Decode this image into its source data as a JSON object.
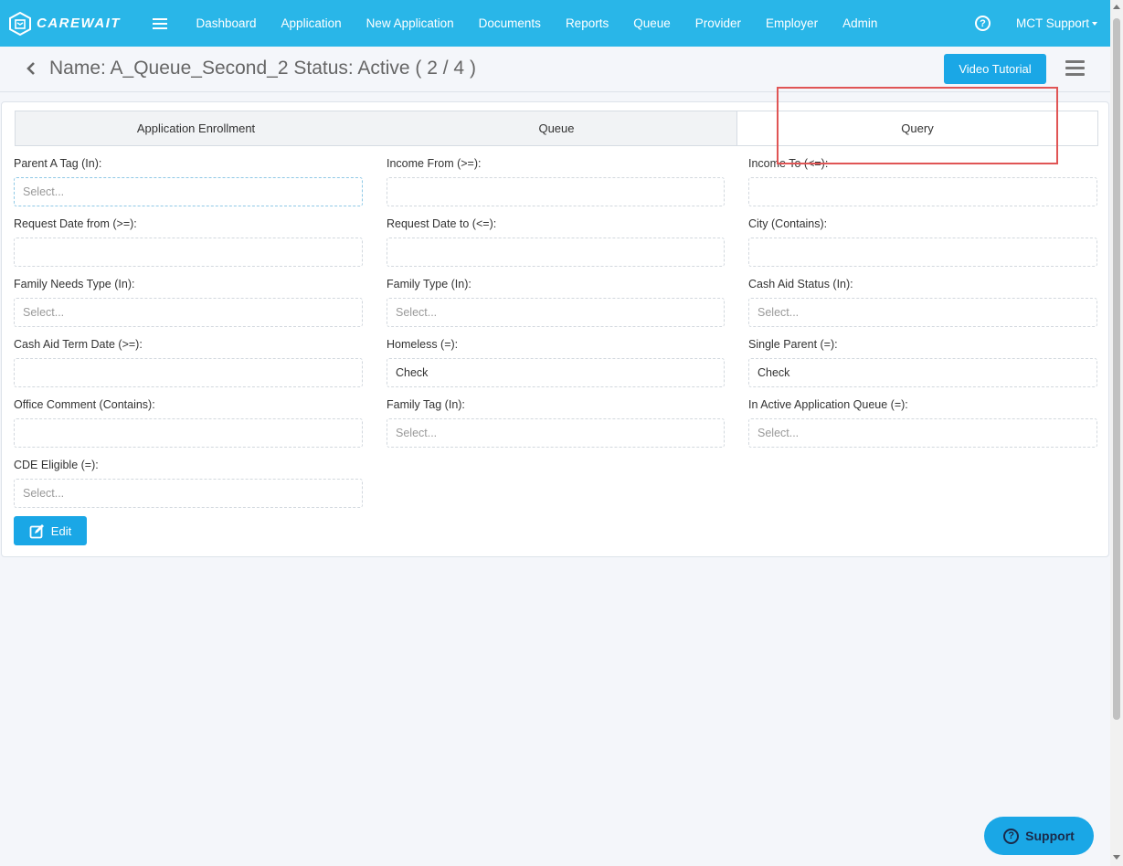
{
  "navbar": {
    "brand": "CAREWAIT",
    "items": [
      {
        "label": "Dashboard"
      },
      {
        "label": "Application"
      },
      {
        "label": "New Application"
      },
      {
        "label": "Documents"
      },
      {
        "label": "Reports"
      },
      {
        "label": "Queue"
      },
      {
        "label": "Provider"
      },
      {
        "label": "Employer"
      },
      {
        "label": "Admin"
      }
    ],
    "help_glyph": "?",
    "user": "MCT Support"
  },
  "header": {
    "title": "Name: A_Queue_Second_2 Status: Active ( 2 / 4 )",
    "video_button": "Video Tutorial"
  },
  "tabs": [
    {
      "label": "Application Enrollment"
    },
    {
      "label": "Queue"
    },
    {
      "label": "Query",
      "active": true
    }
  ],
  "fields": {
    "parent_a_tag": {
      "label": "Parent A Tag (In):",
      "placeholder": "Select..."
    },
    "income_from": {
      "label": "Income From (>=):",
      "value": ""
    },
    "income_to": {
      "label": "Income To (<=):",
      "value": ""
    },
    "request_date_from": {
      "label": "Request Date from (>=):",
      "value": ""
    },
    "request_date_to": {
      "label": "Request Date to (<=):",
      "value": ""
    },
    "city": {
      "label": "City (Contains):",
      "value": ""
    },
    "family_needs_type": {
      "label": "Family Needs Type (In):",
      "placeholder": "Select..."
    },
    "family_type": {
      "label": "Family Type (In):",
      "placeholder": "Select..."
    },
    "cash_aid_status": {
      "label": "Cash Aid Status (In):",
      "placeholder": "Select..."
    },
    "cash_aid_term_date": {
      "label": "Cash Aid Term Date (>=):",
      "value": ""
    },
    "homeless": {
      "label": "Homeless (=):",
      "value": "Check"
    },
    "single_parent": {
      "label": "Single Parent (=):",
      "value": "Check"
    },
    "office_comment": {
      "label": "Office Comment (Contains):",
      "value": ""
    },
    "family_tag": {
      "label": "Family Tag (In):",
      "placeholder": "Select..."
    },
    "in_active_application_queue": {
      "label": "In Active Application Queue (=):",
      "placeholder": "Select..."
    },
    "cde_eligible": {
      "label": "CDE Eligible (=):",
      "placeholder": "Select..."
    }
  },
  "edit_button": "Edit",
  "support_button": "Support",
  "colors": {
    "navbar": "#29b6e8",
    "primary_button": "#1aa7e6",
    "annotation": "#e05555"
  }
}
